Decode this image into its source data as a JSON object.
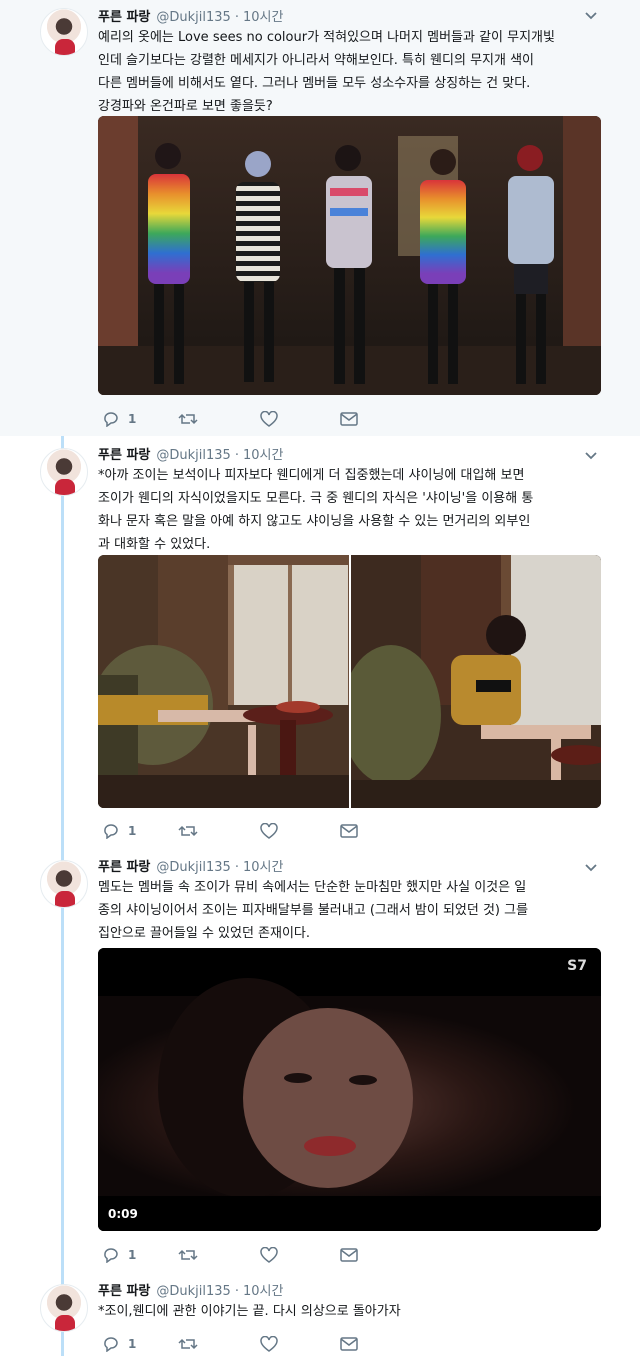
{
  "tweets": [
    {
      "name": "푸른 파랑",
      "handle": "@Dukjil135",
      "sep": "·",
      "time": "10시간",
      "text": "예리의 옷에는 Love sees no colour가 적혀있으며 나머지 멤버들과 같이 무지개빛\n인데 슬기보다는 강렬한 메세지가 아니라서 약해보인다. 특히 웬디의 무지개 색이\n다른 멤버들에 비해서도 옅다. 그러나 멤버들 모두 성소수자를 상징하는 건 맞다.\n강경파와 온건파로 보면 좋을듯?",
      "reply_count": "1",
      "retweet_count": "",
      "like_count": ""
    },
    {
      "name": "푸른 파랑",
      "handle": "@Dukjil135",
      "sep": "·",
      "time": "10시간",
      "text": "*아까 조이는 보석이나 피자보다 웬디에게 더 집중했는데 샤이닝에 대입해 보면\n조이가 웬디의 자식이었을지도 모른다. 극 중 웬디의 자식은 '샤이닝'을 이용해 통\n화나 문자 혹은 말을 아예 하지 않고도 샤이닝을 사용할 수 있는 먼거리의 외부인\n과 대화할 수 있었다.",
      "reply_count": "1",
      "retweet_count": "",
      "like_count": ""
    },
    {
      "name": "푸른 파랑",
      "handle": "@Dukjil135",
      "sep": "·",
      "time": "10시간",
      "text": "멤도는 멤버들 속 조이가 뮤비 속에서는 단순한 눈마침만 했지만 사실 이것은 일\n종의 샤이닝이어서 조이는 피자배달부를 불러내고 (그래서 밤이 되었던 것) 그를\n집안으로 끌어들일 수 있었던 존재이다.",
      "video_duration": "0:09",
      "video_logo": "S7",
      "reply_count": "1",
      "retweet_count": "",
      "like_count": ""
    },
    {
      "name": "푸른 파랑",
      "handle": "@Dukjil135",
      "sep": "·",
      "time": "10시간",
      "text": "*조이,웬디에 관한 이야기는 끝. 다시 의상으로 돌아가자",
      "reply_count": "1",
      "retweet_count": "",
      "like_count": ""
    }
  ],
  "colors": {
    "thread_line": "#bcdff8",
    "highlight_bg": "#f5f8fa",
    "secondary_text": "#657786"
  }
}
